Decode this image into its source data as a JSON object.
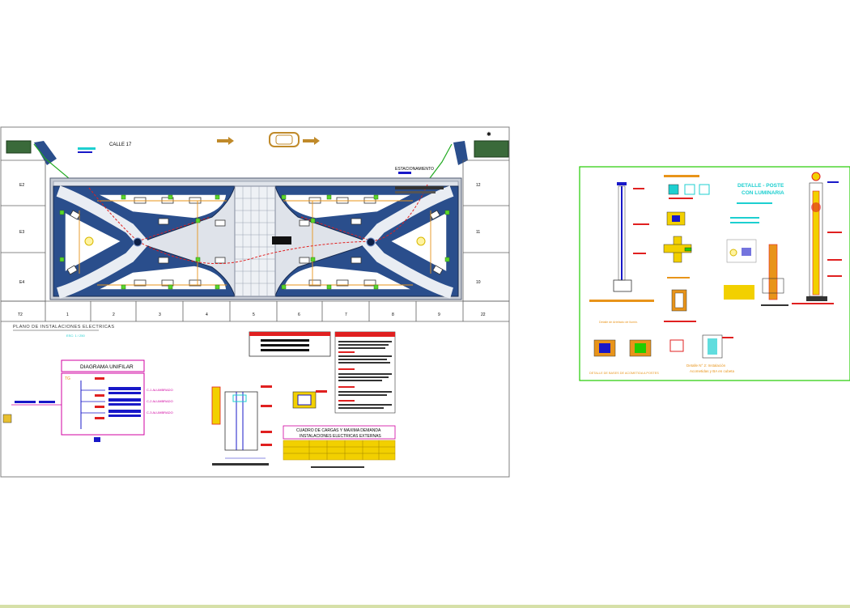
{
  "main_sheet": {
    "street_label": "CALLE 17",
    "parking_label": "ESTACIONAMIENTO",
    "plan_title": "PLANO DE INSTALACIONES ELECTRICAS",
    "plan_scale": "ESC: 1 / 250",
    "left_lots": [
      "E2",
      "E3",
      "E4"
    ],
    "right_lots": [
      "12",
      "11",
      "10"
    ],
    "bottom_lots": [
      "T2",
      "1",
      "2",
      "3",
      "4",
      "5",
      "6",
      "7",
      "8",
      "9",
      "22"
    ],
    "diagram_title": "DIAGRAMA UNIFILAR",
    "panel_label": "TG",
    "circuits": [
      "C-1 ALUMBRADO",
      "C-2 ALUMBRADO",
      "C-3 ALUMBRADO"
    ],
    "loads_title_1": "CUADRO DE CARGAS Y MAXIMA DEMANDA",
    "loads_title_2": "INSTALACIONES ELECTRICAS EXTERNAS"
  },
  "detail_sheet": {
    "title_1": "DETALLE - POSTE",
    "title_2": "CON LUMINARIA",
    "note_1": "Detalle de Artefacto de Ilumin.",
    "note_2": "DETALLE DE BASES DE ACOMETIDA A POSTES",
    "note_3": "Detalle N° 2: Instalación",
    "note_4": "Acometidas y BA en cubeta"
  },
  "colors": {
    "frame": "#808080",
    "paving": "#2a4e8c",
    "grass": "#2e7d32",
    "route": "#e02020",
    "magenta": "#d000a0",
    "blue_bar": "#1818c8",
    "yellow": "#f2d000",
    "green_frame": "#22cc00"
  }
}
